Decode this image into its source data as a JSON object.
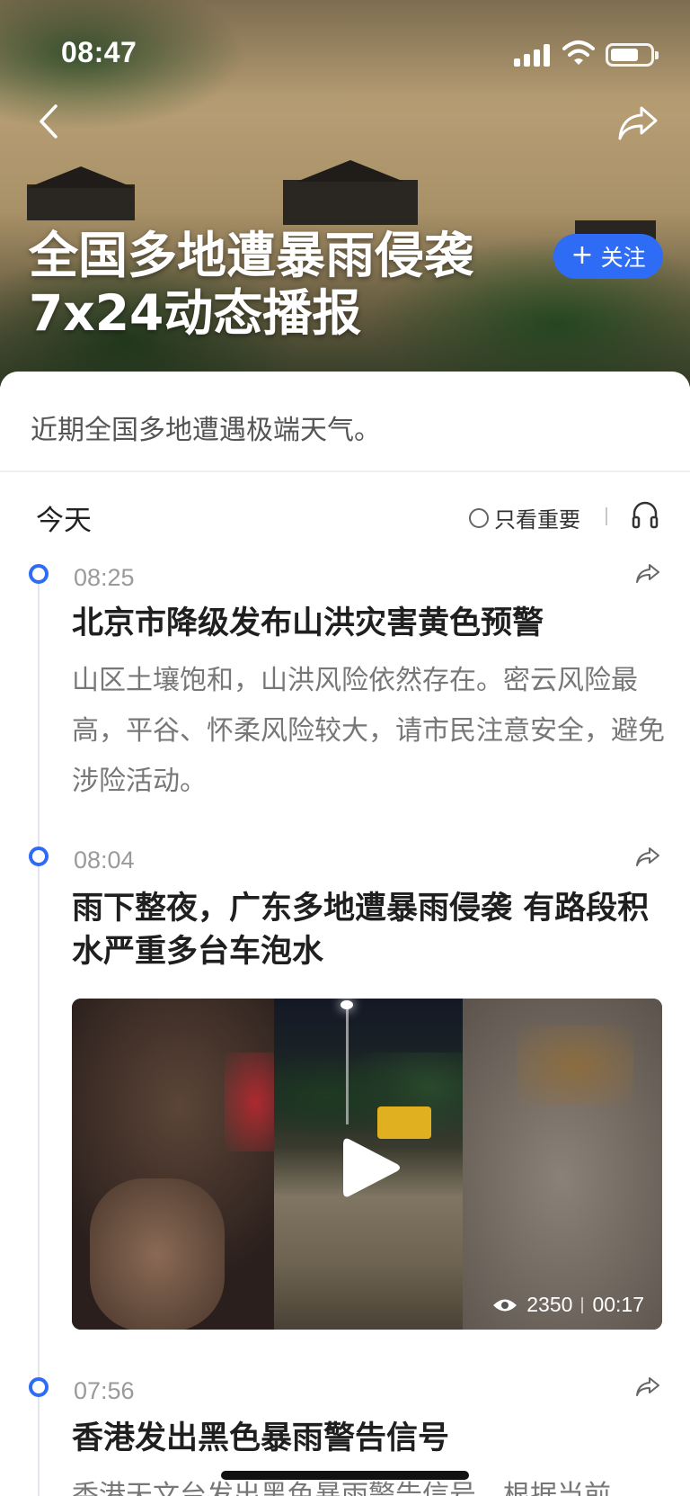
{
  "status_bar": {
    "time": "08:47"
  },
  "hero": {
    "title_line1": "全国多地遭暴雨侵袭",
    "title_line2": "7x24动态播报",
    "follow_label": "关注"
  },
  "intro": "近期全国多地遭遇极端天气。",
  "timeline": {
    "day_label": "今天",
    "filter_label": "只看重要",
    "entries": [
      {
        "time": "08:25",
        "title": "北京市降级发布山洪灾害黄色预警",
        "body": "山区土壤饱和，山洪风险依然存在。密云风险最高，平谷、怀柔风险较大，请市民注意安全，避免涉险活动。"
      },
      {
        "time": "08:04",
        "title": "雨下整夜，广东多地遭暴雨侵袭 有路段积水严重多台车泡水",
        "video": {
          "views": "2350",
          "duration": "00:17"
        }
      },
      {
        "time": "07:56",
        "title": "香港发出黑色暴雨警告信号",
        "body": "香港天文台发出黑色暴雨警告信号，根据当前"
      }
    ]
  },
  "colors": {
    "accent": "#2f6cf6",
    "hero_text": "#ffffff",
    "muted_text": "#777777",
    "time_text": "#9a9a9a"
  }
}
